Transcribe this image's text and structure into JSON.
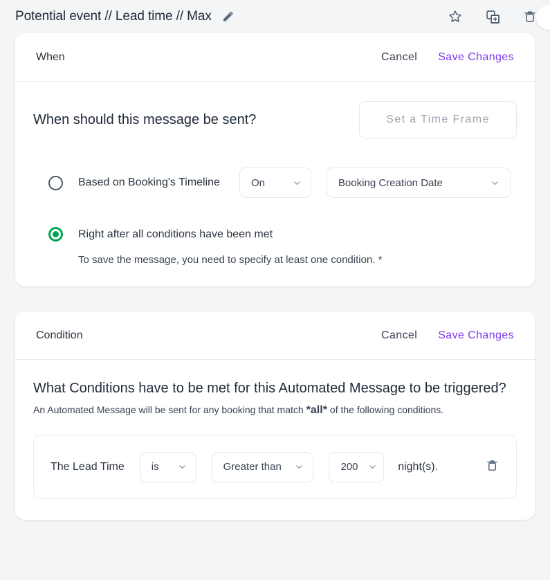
{
  "topbar": {
    "title": "Potential event // Lead time // Max",
    "edit_icon": "pencil-icon",
    "actions": [
      {
        "name": "favorite-button",
        "icon": "star-icon"
      },
      {
        "name": "duplicate-button",
        "icon": "duplicate-icon"
      },
      {
        "name": "delete-button",
        "icon": "trash-icon"
      }
    ],
    "avatar": "avatar-circle"
  },
  "when_card": {
    "header": {
      "title": "When",
      "cancel_label": "Cancel",
      "save_label": "Save Changes"
    },
    "question": "When should this message be sent?",
    "time_frame_button": "Set a Time Frame",
    "options": [
      {
        "label": "Based on Booking's Timeline",
        "selected": false,
        "offset_select": {
          "value": "On",
          "icon": "chevron-down-icon"
        },
        "anchor_select": {
          "value": "Booking Creation Date",
          "icon": "chevron-down-icon"
        }
      },
      {
        "label": "Right after all conditions have been met",
        "selected": true
      }
    ],
    "hint": "To save the message, you need to specify at least one condition. *"
  },
  "condition_card": {
    "header": {
      "title": "Condition",
      "cancel_label": "Cancel",
      "save_label": "Save Changes"
    },
    "question": "What Conditions have to be met for this Automated Message to be triggered?",
    "subtitle_before": "An Automated Message will be sent for any booking that match",
    "subtitle_emphasis": "*all*",
    "subtitle_after": "of the following conditions.",
    "rows": [
      {
        "subject": "The Lead Time",
        "verb_select": {
          "value": "is",
          "icon": "chevron-down-icon"
        },
        "operator_select": {
          "value": "Greater than",
          "icon": "chevron-down-icon"
        },
        "amount_select": {
          "value": "200",
          "icon": "chevron-down-icon"
        },
        "unit": "night(s).",
        "delete_icon": "trash-icon"
      }
    ]
  },
  "colors": {
    "accent_purple": "#7c3aed",
    "radio_green": "#00a651",
    "page_background": "#f4f5f7",
    "card_background": "#ffffff",
    "border": "#e5e7eb",
    "text_primary": "#1f2937",
    "text_muted": "#9aa2ae"
  }
}
